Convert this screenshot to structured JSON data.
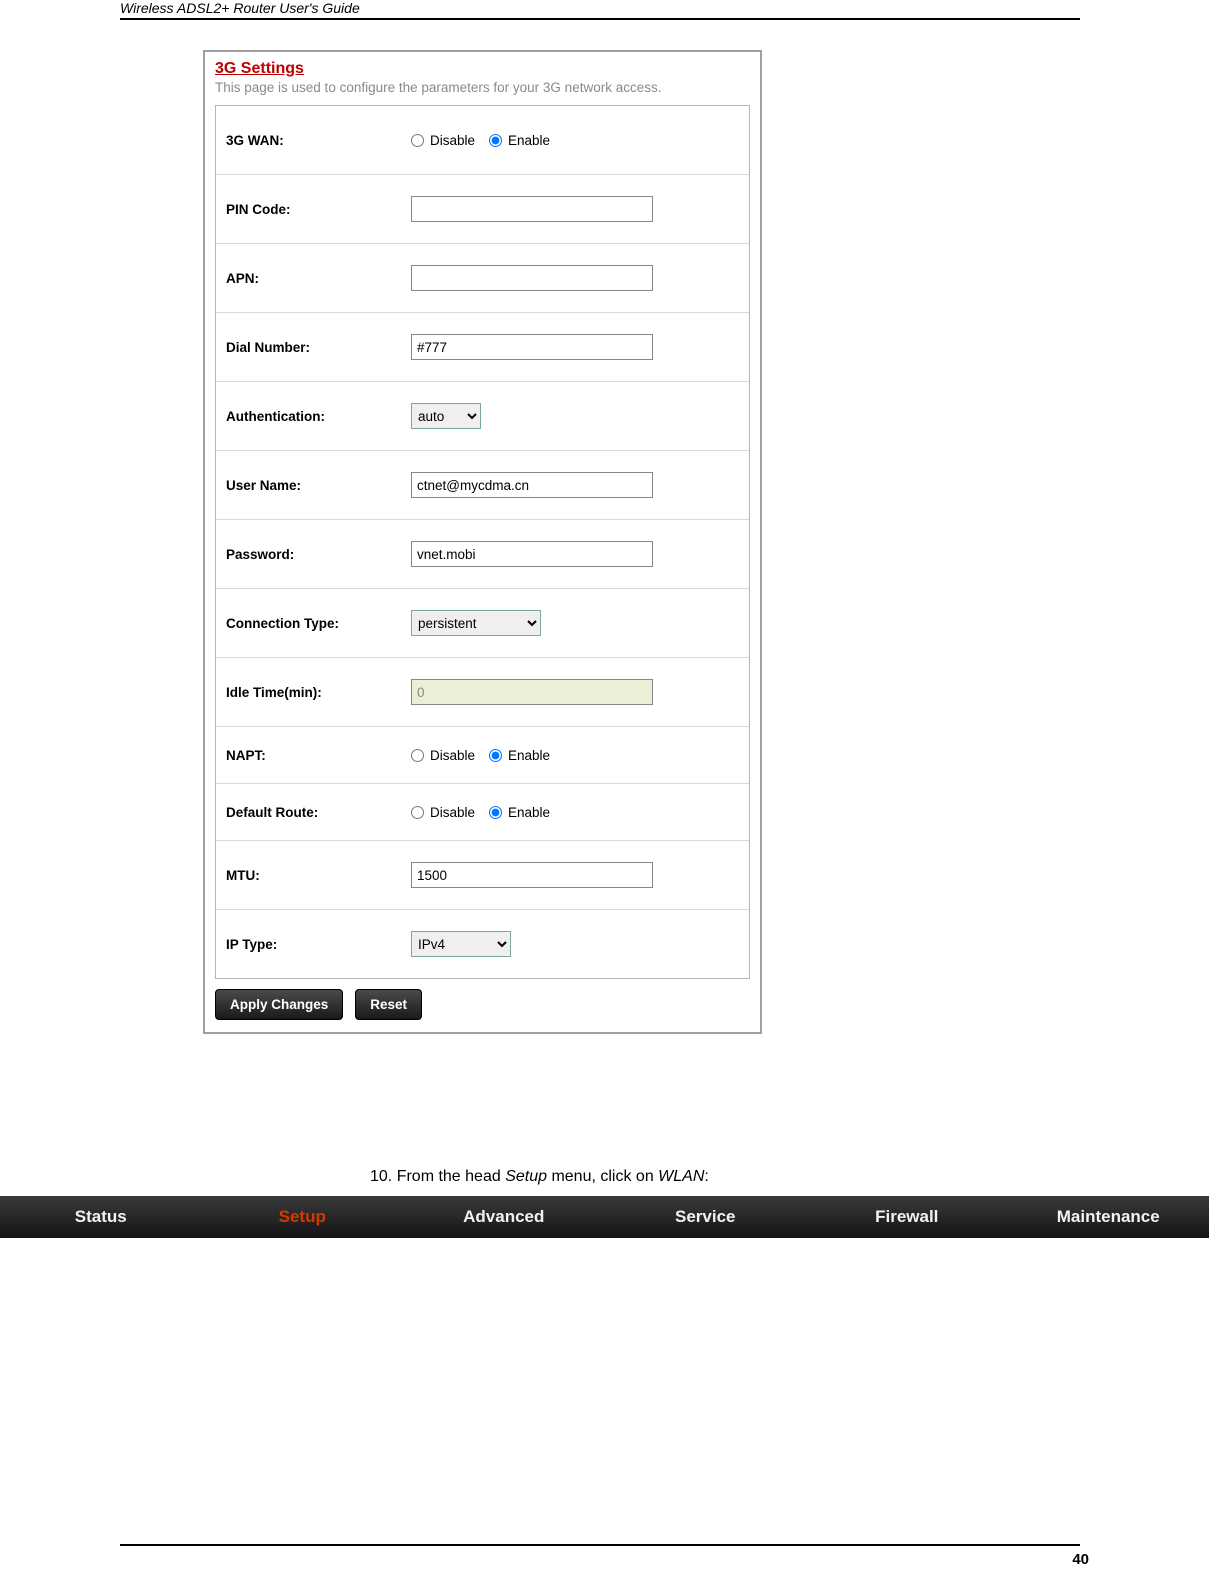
{
  "doc": {
    "header": "Wireless ADSL2+ Router User's Guide",
    "page_number": "40"
  },
  "panel": {
    "title": "3G Settings",
    "description": "This page is used to configure the parameters for your 3G network access."
  },
  "form": {
    "wan3g": {
      "label": "3G WAN:",
      "disable": "Disable",
      "enable": "Enable",
      "value": "enable"
    },
    "pin": {
      "label": "PIN Code:",
      "value": ""
    },
    "apn": {
      "label": "APN:",
      "value": ""
    },
    "dial": {
      "label": "Dial Number:",
      "value": "#777"
    },
    "auth": {
      "label": "Authentication:",
      "value": "auto"
    },
    "user": {
      "label": "User Name:",
      "value": "ctnet@mycdma.cn"
    },
    "pass": {
      "label": "Password:",
      "value": "vnet.mobi"
    },
    "conn": {
      "label": "Connection Type:",
      "value": "persistent"
    },
    "idle": {
      "label": "Idle Time(min):",
      "value": "0"
    },
    "napt": {
      "label": "NAPT:",
      "disable": "Disable",
      "enable": "Enable",
      "value": "enable"
    },
    "route": {
      "label": "Default Route:",
      "disable": "Disable",
      "enable": "Enable",
      "value": "enable"
    },
    "mtu": {
      "label": "MTU:",
      "value": "1500"
    },
    "iptype": {
      "label": "IP Type:",
      "value": "IPv4"
    }
  },
  "buttons": {
    "apply": "Apply Changes",
    "reset": "Reset"
  },
  "instruction": {
    "prefix": "10.  From the head ",
    "setup": "Setup",
    "mid": " menu, click on ",
    "wlan": "WLAN",
    "suffix": ":"
  },
  "nav": {
    "status": "Status",
    "setup": "Setup",
    "advanced": "Advanced",
    "service": "Service",
    "firewall": "Firewall",
    "maintenance": "Maintenance"
  }
}
